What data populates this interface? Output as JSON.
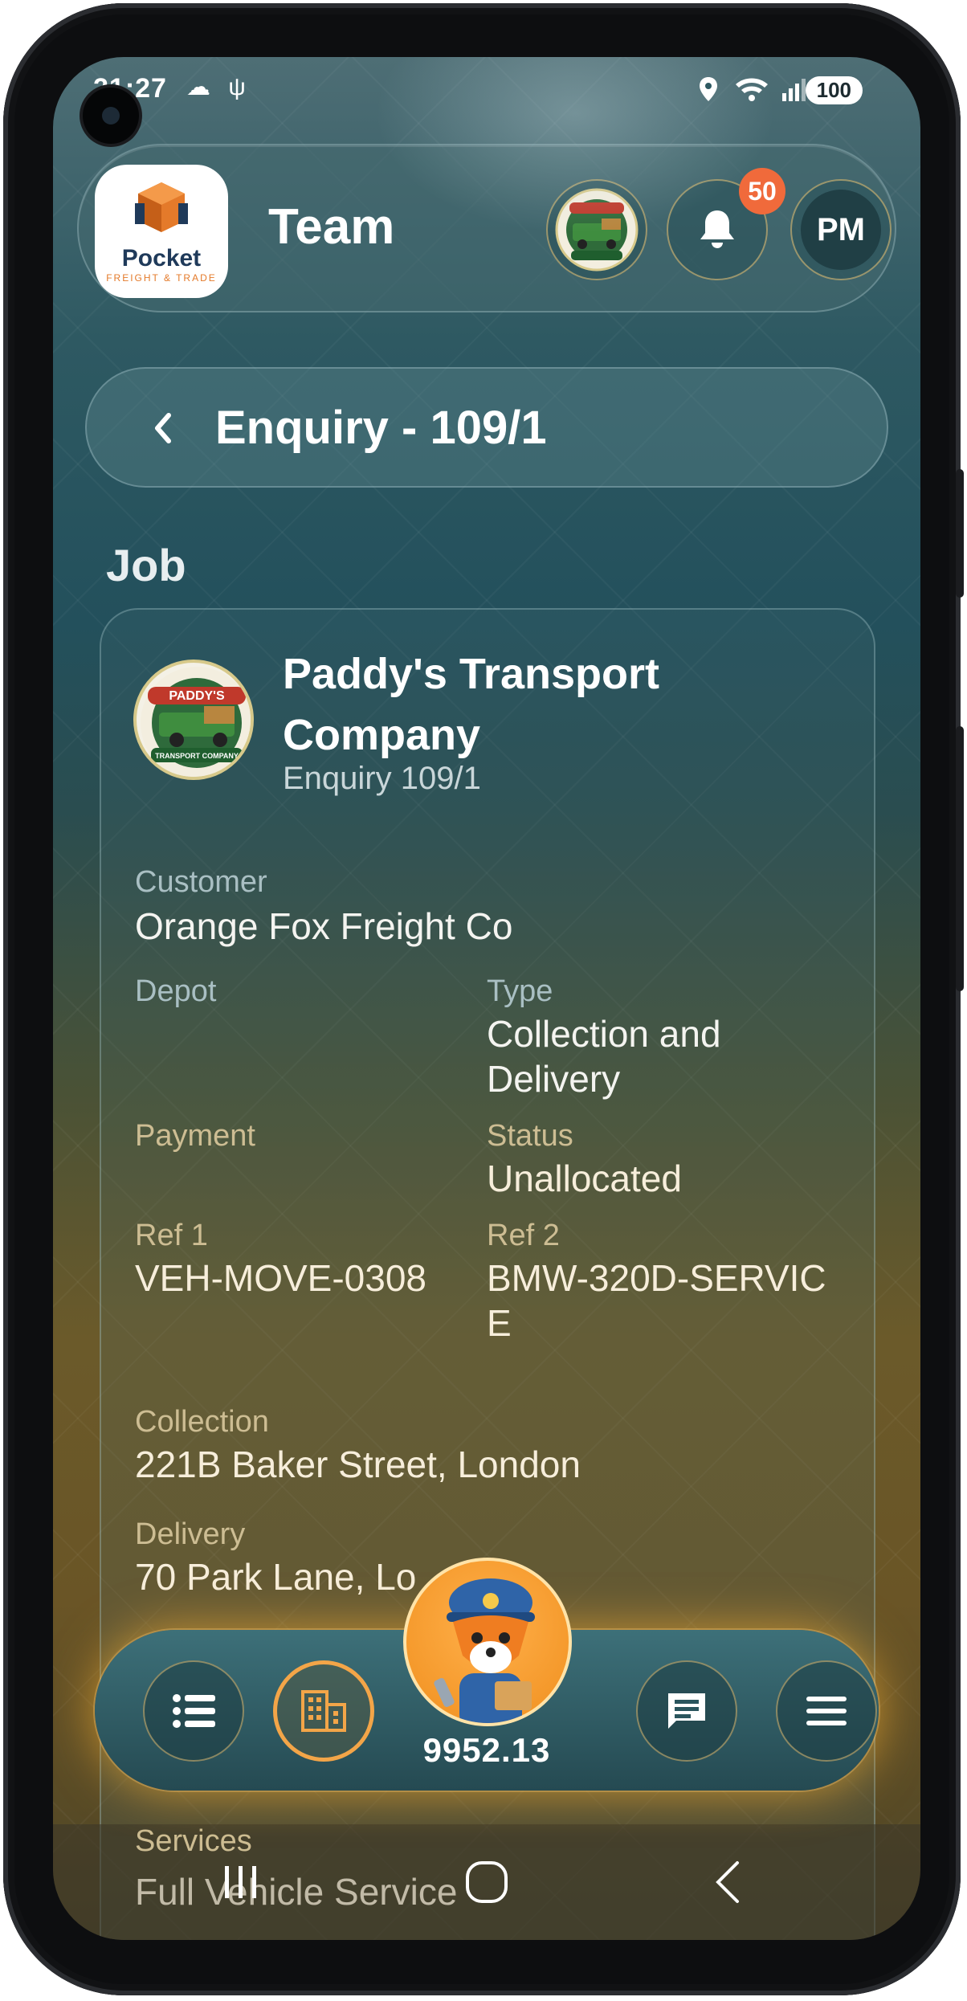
{
  "status_bar": {
    "time": "21:27",
    "battery": "100"
  },
  "header": {
    "title": "Team",
    "notification_count": "50",
    "profile_initials": "PM"
  },
  "logo": {
    "name": "Pocket",
    "tagline": "FREIGHT & TRADE"
  },
  "enquiry_bar": {
    "title": "Enquiry - 109/1"
  },
  "section": {
    "title": "Job"
  },
  "company": {
    "name": "Paddy's Transport Company",
    "subtitle": "Enquiry 109/1",
    "logo_text_top": "PADDY'S",
    "logo_text_bottom": "TRANSPORT COMPANY"
  },
  "fields": {
    "customer_label": "Customer",
    "customer_value": "Orange Fox Freight Co",
    "depot_label": "Depot",
    "depot_value": "",
    "type_label": "Type",
    "type_value": "Collection and Delivery",
    "payment_label": "Payment",
    "payment_value": "",
    "status_label": "Status",
    "status_value": "Unallocated",
    "ref1_label": "Ref 1",
    "ref1_value": "VEH-MOVE-0308",
    "ref2_label": "Ref 2",
    "ref2_value": "BMW-320D-SERVIC E",
    "collection_label": "Collection",
    "collection_value": "221B Baker Street, London",
    "delivery_label": "Delivery",
    "delivery_value": "70 Park Lane, Lo",
    "services_label": "Services",
    "services_value": "Full Vehicle Service"
  },
  "bottom_nav": {
    "balance": "9952.13"
  },
  "icons": [
    "cloud-icon",
    "usb-icon",
    "location-icon",
    "wifi-icon",
    "signal-icon",
    "bell-icon",
    "back-chevron-icon",
    "list-icon",
    "building-icon",
    "chat-icon",
    "menu-icon",
    "fox-mascot-icon",
    "recents-icon",
    "home-icon",
    "back-icon"
  ],
  "colors": {
    "accent_orange": "#f3a548",
    "badge": "#f06a3b",
    "teal": "#23505c"
  }
}
